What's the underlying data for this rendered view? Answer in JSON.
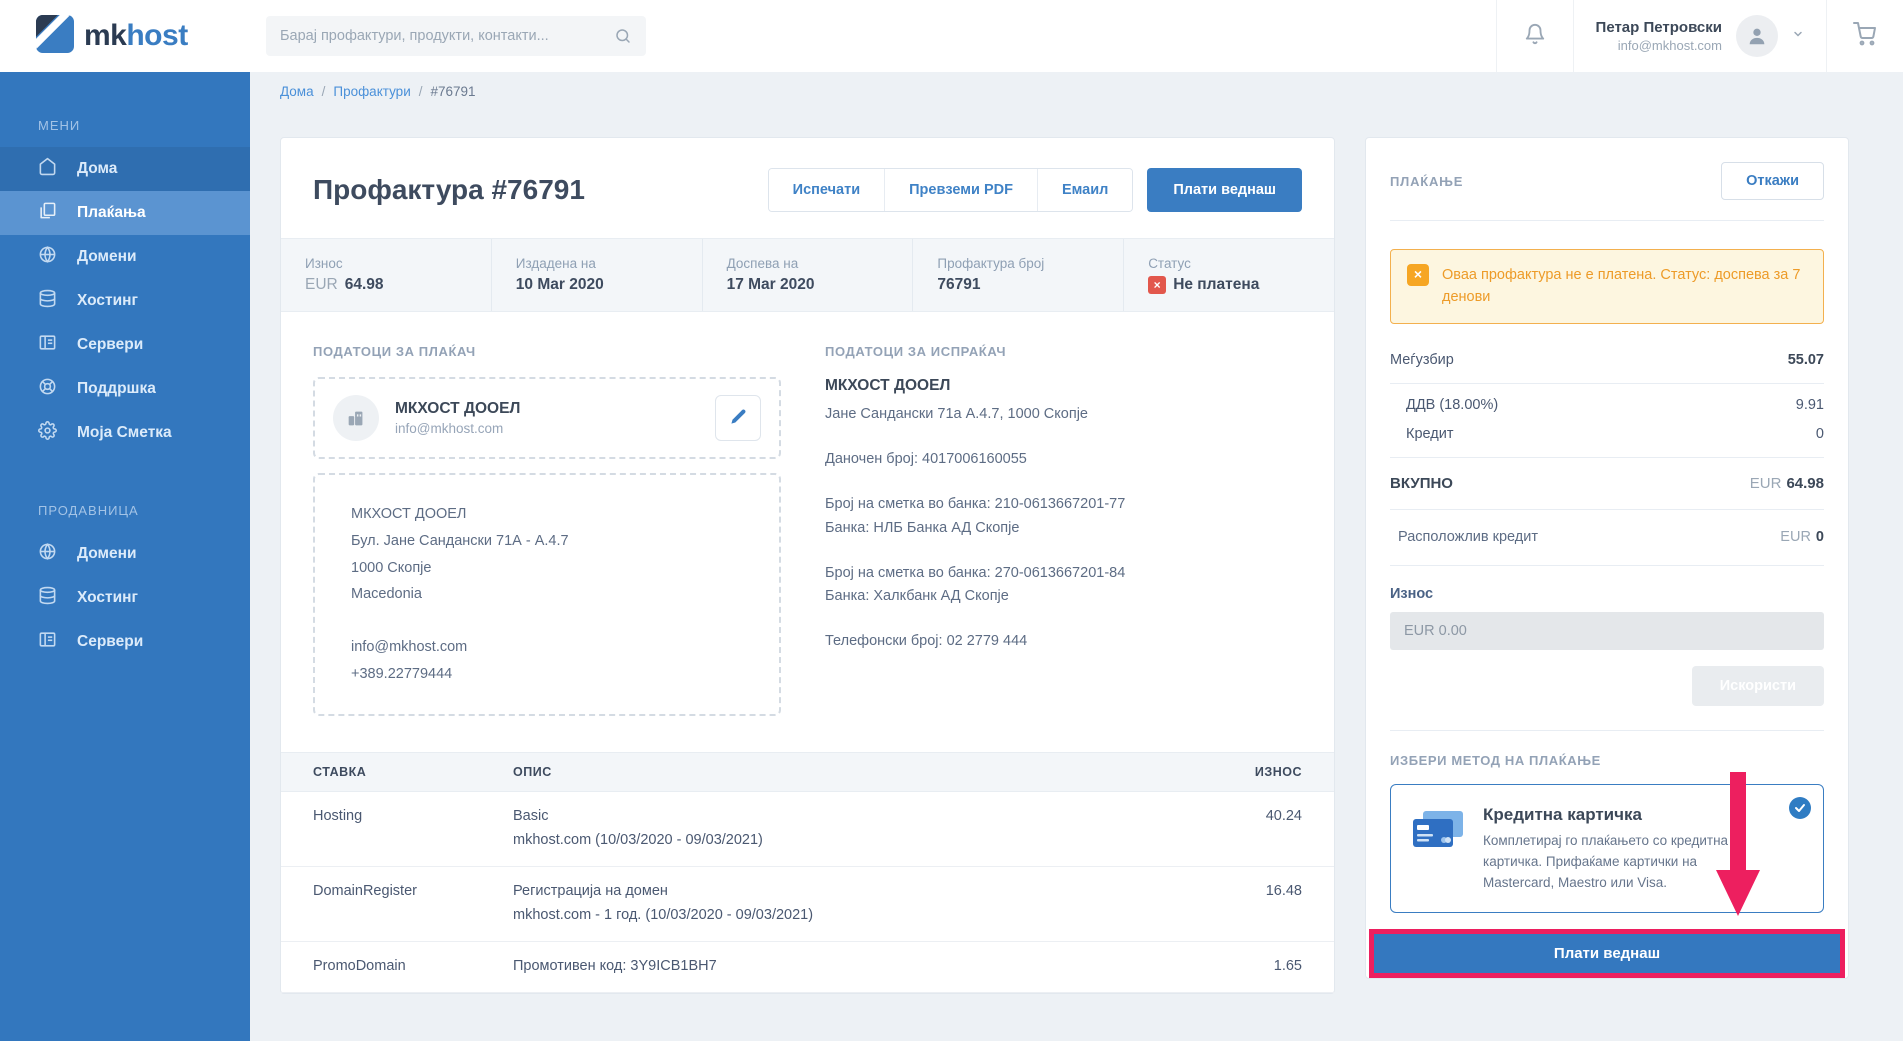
{
  "colors": {
    "accent_blue": "#3a7dc2",
    "sidebar_blue": "#3377be",
    "active_item_blue": "#5b94d1",
    "highlight_pink": "#ed1f5f",
    "warning_orange": "#ed9b28",
    "status_red": "#e2574c"
  },
  "topbar": {
    "logo_mk": "mk",
    "logo_host": "host",
    "search_placeholder": "Барај профактури, продукти, контакти...",
    "user_name": "Петар Петровски",
    "user_email": "info@mkhost.com"
  },
  "breadcrumb": {
    "home": "Дома",
    "sep1": "/",
    "section": "Профактури",
    "sep2": "/",
    "current": "#76791"
  },
  "sidebar": {
    "menu_label": "МЕНИ",
    "items": [
      {
        "label": "Дома"
      },
      {
        "label": "Плаќања"
      },
      {
        "label": "Домени"
      },
      {
        "label": "Хостинг"
      },
      {
        "label": "Сервери"
      },
      {
        "label": "Поддршка"
      },
      {
        "label": "Моја Сметка"
      }
    ],
    "shop_label": "ПРОДАВНИЦА",
    "shop_items": [
      {
        "label": "Домени"
      },
      {
        "label": "Хостинг"
      },
      {
        "label": "Сервери"
      }
    ]
  },
  "invoice": {
    "title": "Профактура #76791",
    "actions": {
      "print": "Испечати",
      "pdf": "Превземи PDF",
      "email": "Емаил",
      "pay": "Плати веднаш"
    },
    "stats": {
      "amount_label": "Износ",
      "amount_currency": "EUR",
      "amount_value": "64.98",
      "issued_label": "Издадена на",
      "issued_value": "10 Mar 2020",
      "due_label": "Доспева на",
      "due_value": "17 Mar 2020",
      "number_label": "Профактура број",
      "number_value": "76791",
      "status_label": "Статус",
      "status_value": "Не платена",
      "status_icon": "×"
    },
    "payer": {
      "section_title": "ПОДАТОЦИ ЗА ПЛАЌАЧ",
      "company": "МКХОСТ ДООЕЛ",
      "email": "info@mkhost.com",
      "address_company": "МКХОСТ ДООЕЛ",
      "address_street": "Бул. Јане Сандански 71А - А.4.7",
      "address_city": "1000 Скопје",
      "address_country": "Macedonia",
      "address_email": "info@mkhost.com",
      "address_phone": "+389.22779444"
    },
    "sender": {
      "section_title": "ПОДАТОЦИ ЗА ИСПРАЌАЧ",
      "company": "МКХОСТ ДООЕЛ",
      "address": "Јане Сандански 71а А.4.7, 1000 Скопје",
      "tax_number": "Даночен број: 4017006160055",
      "bank1_account": "Број на сметка во банка: 210-0613667201-77",
      "bank1_name": "Банка: НЛБ Банка АД Скопје",
      "bank2_account": "Број на сметка во банка: 270-0613667201-84",
      "bank2_name": "Банка: Халкбанк АД Скопје",
      "phone": "Телефонски број: 02 2779 444"
    },
    "table": {
      "col_item": "СТАВКА",
      "col_desc": "ОПИС",
      "col_amount": "ИЗНОС",
      "rows": [
        {
          "item": "Hosting",
          "desc1": "Basic",
          "desc2": "mkhost.com (10/03/2020 - 09/03/2021)",
          "amount": "40.24"
        },
        {
          "item": "DomainRegister",
          "desc1": "Регистрација на домен",
          "desc2": "mkhost.com - 1 год. (10/03/2020 - 09/03/2021)",
          "amount": "16.48"
        },
        {
          "item": "PromoDomain",
          "desc1": "Промотивен код: 3Y9ICB1BH7",
          "desc2": "",
          "amount": "1.65"
        }
      ]
    }
  },
  "payment": {
    "title": "ПЛАЌАЊЕ",
    "cancel": "Откажи",
    "warning": "Оваа профактура не е платена. Статус: доспева за 7 денови",
    "warning_icon": "×",
    "subtotal_label": "Меѓузбир",
    "subtotal": "55.07",
    "vat_label": "ДДВ (18.00%)",
    "vat": "9.91",
    "credit_label": "Кредит",
    "credit": "0",
    "total_label": "ВКУПНО",
    "total_currency": "EUR",
    "total": "64.98",
    "available_label": "Расположлив кредит",
    "available_currency": "EUR",
    "available": "0",
    "amount_label": "Износ",
    "amount_placeholder": "EUR 0.00",
    "use_button": "Искористи",
    "method_title": "ИЗБЕРИ МЕТОД НА ПЛАЌАЊЕ",
    "method_name": "Кредитна картичка",
    "method_desc": "Комплетирај го плаќањето со кредитна картичка. Прифаќаме картички на Mastercard, Maestro или Visa.",
    "pay_button": "Плати веднаш"
  }
}
